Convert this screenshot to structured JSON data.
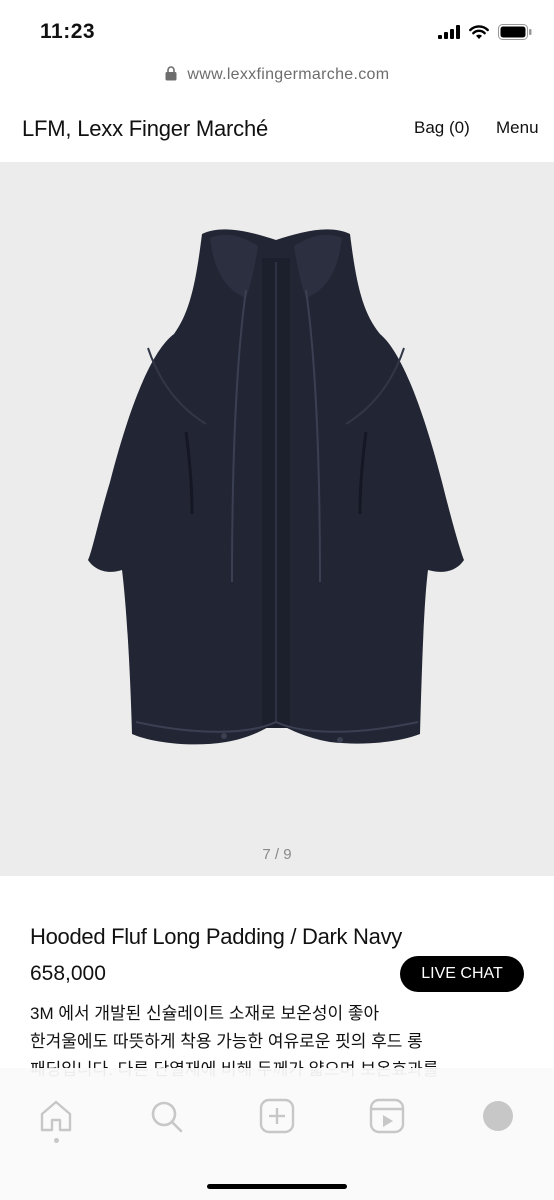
{
  "status_bar": {
    "time": "11:23",
    "icons": [
      "signal-icon",
      "wifi-icon",
      "battery-icon"
    ]
  },
  "browser": {
    "url": "www.lexxfingermarche.com",
    "lock_icon": "lock-icon"
  },
  "header": {
    "brand": "LFM, Lexx Finger Marché",
    "bag": "Bag (0)",
    "menu": "Menu"
  },
  "gallery": {
    "pager": "7 / 9",
    "image_subject": "coat-photo",
    "colors": {
      "background": "#ececec",
      "coat": "#222533"
    }
  },
  "product": {
    "name": "Hooded Fluf Long Padding / Dark Navy",
    "price": "658,000",
    "live_chat": "LIVE CHAT",
    "description_line1": "3M 에서 개발된 신슐레이트 소재로 보온성이 좋아",
    "description_line2": "한겨울에도 따뜻하게 착용 가능한 여유로운 핏의 후드 롱",
    "description_line3": "패딩입니다. 다른 단열재에 비해 두께가 얇으며 보온효과를"
  },
  "bottom_nav": {
    "items": [
      "home-icon",
      "search-icon",
      "add-icon",
      "reels-icon",
      "profile-icon"
    ]
  }
}
